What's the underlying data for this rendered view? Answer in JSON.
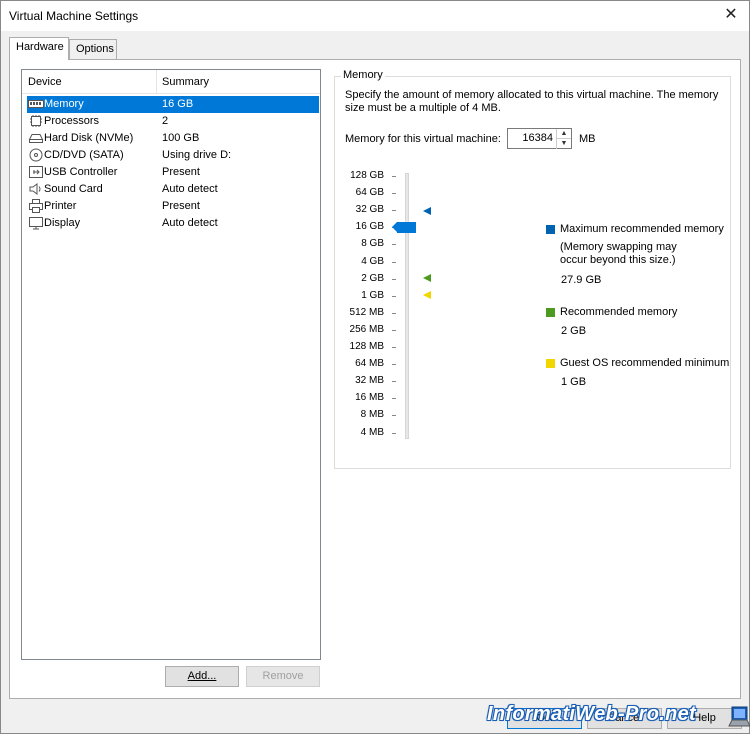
{
  "window": {
    "title": "Virtual Machine Settings",
    "close_glyph": "✕"
  },
  "tabs": [
    {
      "label": "Hardware",
      "active": true
    },
    {
      "label": "Options",
      "active": false
    }
  ],
  "device_list": {
    "headers": {
      "device": "Device",
      "summary": "Summary"
    },
    "rows": [
      {
        "name": "Memory",
        "summary": "16 GB",
        "icon": "memory-icon",
        "selected": true
      },
      {
        "name": "Processors",
        "summary": "2",
        "icon": "processor-icon"
      },
      {
        "name": "Hard Disk (NVMe)",
        "summary": "100 GB",
        "icon": "hard-disk-icon"
      },
      {
        "name": "CD/DVD (SATA)",
        "summary": "Using drive D:",
        "icon": "cd-dvd-icon"
      },
      {
        "name": "USB Controller",
        "summary": "Present",
        "icon": "usb-icon"
      },
      {
        "name": "Sound Card",
        "summary": "Auto detect",
        "icon": "speaker-icon"
      },
      {
        "name": "Printer",
        "summary": "Present",
        "icon": "printer-icon"
      },
      {
        "name": "Display",
        "summary": "Auto detect",
        "icon": "monitor-icon"
      }
    ],
    "add_button": "Add...",
    "remove_button": "Remove"
  },
  "memory": {
    "group_title": "Memory",
    "description": "Specify the amount of memory allocated to this virtual machine. The memory size must be a multiple of 4 MB.",
    "field_label": "Memory for this virtual machine:",
    "value": "16384",
    "unit": "MB",
    "scale": [
      "128 GB",
      "64 GB",
      "32 GB",
      "16 GB",
      "8 GB",
      "4 GB",
      "2 GB",
      "1 GB",
      "512 MB",
      "256 MB",
      "128 MB",
      "64 MB",
      "32 MB",
      "16 MB",
      "8 MB",
      "4 MB"
    ],
    "slider_value": "16 GB",
    "legend": {
      "max_label": "Maximum recommended memory",
      "max_note": "(Memory swapping may occur beyond this size.)",
      "max_value": "27.9 GB",
      "rec_label": "Recommended memory",
      "rec_value": "2 GB",
      "min_label": "Guest OS recommended minimum",
      "min_value": "1 GB"
    },
    "colors": {
      "max": "#0063b1",
      "rec": "#4c9a1f",
      "min": "#f2d600",
      "thumb": "#0078d7"
    }
  },
  "footer": {
    "ok": "OK",
    "cancel": "Cancel",
    "help": "Help",
    "watermark": "InformatiWeb-Pro.net"
  }
}
